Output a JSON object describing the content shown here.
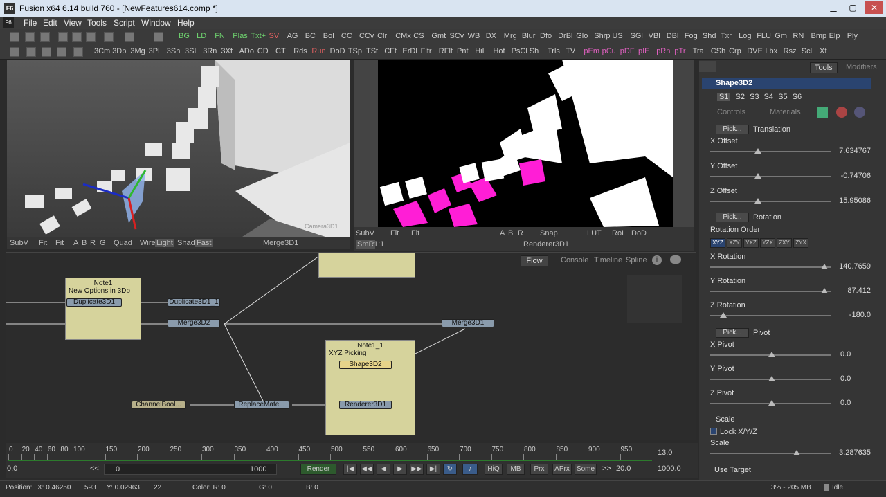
{
  "window": {
    "title": "Fusion x64 6.14 build 760 - [NewFeatures614.comp *]",
    "logo": "F6",
    "controls": [
      "minimize",
      "maximize",
      "close"
    ]
  },
  "menu": [
    "File",
    "Edit",
    "View",
    "Tools",
    "Script",
    "Window",
    "Help"
  ],
  "toolbar1": [
    "BG",
    "LD",
    "FN",
    "Plas",
    "Txt+",
    "SV",
    "AG",
    "BC",
    "Bol",
    "CC",
    "CCv",
    "Clr",
    "CMx",
    "CS",
    "Gmt",
    "SCv",
    "WB",
    "DX",
    "Mrg",
    "Blur",
    "Dfo",
    "DrBl",
    "Glo",
    "Shrp",
    "US",
    "SGl",
    "VBl",
    "DBl",
    "Fog",
    "Shd",
    "Txr",
    "Log",
    "FLU",
    "Gm",
    "RN",
    "Bmp",
    "Elp",
    "Ply"
  ],
  "toolbar2": [
    "3Cm",
    "3Dp",
    "3Mg",
    "3PL",
    "3Sh",
    "3SL",
    "3Rn",
    "3Xf",
    "ADo",
    "CD",
    "CT",
    "Rds",
    "Run",
    "DoD",
    "TSp",
    "TSt",
    "CFt",
    "ErDl",
    "Fltr",
    "RFlt",
    "Pnt",
    "HiL",
    "Hot",
    "PsCl",
    "Sh",
    "Trls",
    "TV",
    "pEm",
    "pCu",
    "pDF",
    "pIE",
    "pRn",
    "pTr",
    "Tra",
    "CSh",
    "Crp",
    "DVE",
    "Lbx",
    "Rsz",
    "Scl",
    "Xf"
  ],
  "left_view": {
    "bar": [
      "SubV",
      "Fit",
      "Fit",
      "A",
      "B",
      "R",
      "G",
      "Quad",
      "Wire",
      "Light",
      "Shad",
      "Fast"
    ],
    "title": "Merge3D1",
    "camera_label": "Camera3D1"
  },
  "right_view": {
    "bar1": [
      "SubV",
      "Fit",
      "Fit",
      "A",
      "B",
      "R",
      "Snap",
      "LUT",
      "RoI",
      "DoD"
    ],
    "bar2": [
      "SmR",
      "1:1"
    ],
    "title": "Renderer3D1"
  },
  "flow": {
    "tabs": [
      "Flow",
      "Console",
      "Timeline",
      "Spline"
    ],
    "notes": [
      {
        "title": "Note1",
        "body": "New Options in 3Dp"
      },
      {
        "title": "Note1_1",
        "body": "XYZ Picking"
      }
    ],
    "nodes": [
      "Duplicate3D1",
      "Duplicate3D1_1",
      "Merge3D2",
      "Merge3D1",
      "Shape3D2",
      "ChannelBool...",
      "ReplaceMate...",
      "Renderer3D1"
    ]
  },
  "panel": {
    "tabs": [
      "Tools",
      "Modifiers"
    ],
    "tool_name": "Shape3D2",
    "subtabs": [
      "S1",
      "S2",
      "S3",
      "S4",
      "S5",
      "S6"
    ],
    "ctrl_tabs": [
      "Controls",
      "Materials"
    ],
    "translation": {
      "pick": "Pick...",
      "label": "Translation",
      "x_label": "X Offset",
      "x": "7.634767",
      "y_label": "Y Offset",
      "y": "-0.74706",
      "z_label": "Z Offset",
      "z": "15.95086"
    },
    "rotation": {
      "pick": "Pick...",
      "label": "Rotation",
      "order_label": "Rotation Order",
      "orders": [
        "XYZ",
        "XZY",
        "YXZ",
        "YZX",
        "ZXY",
        "ZYX"
      ],
      "x_label": "X Rotation",
      "x": "140.7659",
      "y_label": "Y Rotation",
      "y": "87.412",
      "z_label": "Z Rotation",
      "z": "-180.0"
    },
    "pivot": {
      "pick": "Pick...",
      "label": "Pivot",
      "x_label": "X Pivot",
      "x": "0.0",
      "y_label": "Y Pivot",
      "y": "0.0",
      "z_label": "Z Pivot",
      "z": "0.0"
    },
    "scale": {
      "label": "Scale",
      "lock": "Lock X/Y/Z",
      "scale_label": "Scale",
      "scale": "3.287635"
    },
    "use_target": "Use Target"
  },
  "timeline": {
    "ticks": [
      "0",
      "20",
      "40",
      "60",
      "80",
      "100",
      "150",
      "200",
      "250",
      "300",
      "350",
      "400",
      "450",
      "500",
      "550",
      "600",
      "650",
      "700",
      "750",
      "800",
      "850",
      "900",
      "950"
    ],
    "end_value": "13.0",
    "render_start": "0.0",
    "global_start": "0",
    "range_end": "1000",
    "render_label": "Render",
    "buttons": [
      "HiQ",
      "MB",
      "Prx",
      "APrx",
      "Some"
    ],
    "fps": "20.0",
    "global_end": "1000.0"
  },
  "status": {
    "position": "Position:",
    "x": "X: 0.46250",
    "xpx": "593",
    "y": "Y: 0.02963",
    "ypx": "22",
    "color": "Color: R: 0",
    "g": "G: 0",
    "b": "B: 0",
    "mem": "3% - 205 MB",
    "state": "Idle"
  }
}
